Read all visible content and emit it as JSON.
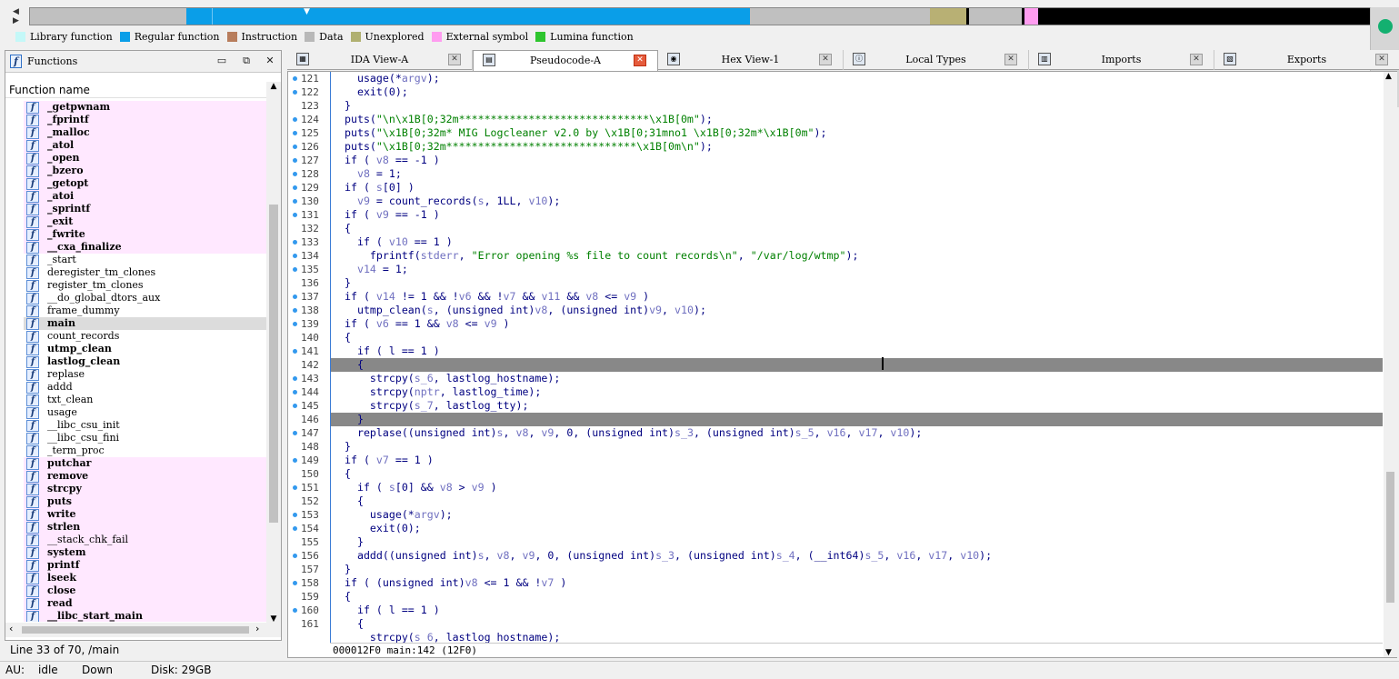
{
  "legend": [
    {
      "label": "Library function",
      "color": "#c4f8f8"
    },
    {
      "label": "Regular function",
      "color": "#0a9ee8"
    },
    {
      "label": "Instruction",
      "color": "#b87d5c"
    },
    {
      "label": "Data",
      "color": "#b8b8b8"
    },
    {
      "label": "Unexplored",
      "color": "#b0b070"
    },
    {
      "label": "External symbol",
      "color": "#ff9cf0"
    },
    {
      "label": "Lumina function",
      "color": "#2ec52e"
    }
  ],
  "functions_panel": {
    "title": "Functions",
    "column_header": "Function name",
    "status": "Line 33 of 70, /main"
  },
  "functions": [
    {
      "name": "_getpwnam",
      "kind": "lib"
    },
    {
      "name": "_fprintf",
      "kind": "lib"
    },
    {
      "name": "_malloc",
      "kind": "lib"
    },
    {
      "name": "_atol",
      "kind": "lib"
    },
    {
      "name": "_open",
      "kind": "lib"
    },
    {
      "name": "_bzero",
      "kind": "lib"
    },
    {
      "name": "_getopt",
      "kind": "lib"
    },
    {
      "name": "_atoi",
      "kind": "lib"
    },
    {
      "name": "_sprintf",
      "kind": "lib"
    },
    {
      "name": "_exit",
      "kind": "lib"
    },
    {
      "name": "_fwrite",
      "kind": "lib"
    },
    {
      "name": "__cxa_finalize",
      "kind": "lib"
    },
    {
      "name": "_start",
      "kind": "reg"
    },
    {
      "name": "deregister_tm_clones",
      "kind": "reg"
    },
    {
      "name": "register_tm_clones",
      "kind": "reg"
    },
    {
      "name": "__do_global_dtors_aux",
      "kind": "reg"
    },
    {
      "name": "frame_dummy",
      "kind": "reg"
    },
    {
      "name": "main",
      "kind": "sel"
    },
    {
      "name": "count_records",
      "kind": "reg"
    },
    {
      "name": "utmp_clean",
      "kind": "bold"
    },
    {
      "name": "lastlog_clean",
      "kind": "bold"
    },
    {
      "name": "replase",
      "kind": "reg"
    },
    {
      "name": "addd",
      "kind": "reg"
    },
    {
      "name": "txt_clean",
      "kind": "reg"
    },
    {
      "name": "usage",
      "kind": "reg"
    },
    {
      "name": "__libc_csu_init",
      "kind": "reg"
    },
    {
      "name": "__libc_csu_fini",
      "kind": "reg"
    },
    {
      "name": "_term_proc",
      "kind": "reg"
    },
    {
      "name": "putchar",
      "kind": "lib"
    },
    {
      "name": "remove",
      "kind": "lib"
    },
    {
      "name": "strcpy",
      "kind": "lib"
    },
    {
      "name": "puts",
      "kind": "lib"
    },
    {
      "name": "write",
      "kind": "lib"
    },
    {
      "name": "strlen",
      "kind": "lib"
    },
    {
      "name": "__stack_chk_fail",
      "kind": "libn"
    },
    {
      "name": "system",
      "kind": "lib"
    },
    {
      "name": "printf",
      "kind": "lib"
    },
    {
      "name": "lseek",
      "kind": "lib"
    },
    {
      "name": "close",
      "kind": "lib"
    },
    {
      "name": "read",
      "kind": "lib"
    },
    {
      "name": "__libc_start_main",
      "kind": "lib"
    }
  ],
  "tabs": [
    {
      "label": "IDA View-A",
      "icon": "graph-icon",
      "active": false
    },
    {
      "label": "Pseudocode-A",
      "icon": "pseudocode-icon",
      "active": true
    },
    {
      "label": "Hex View-1",
      "icon": "hex-icon",
      "active": false
    },
    {
      "label": "Local Types",
      "icon": "info-icon",
      "active": false
    },
    {
      "label": "Imports",
      "icon": "imports-icon",
      "active": false
    },
    {
      "label": "Exports",
      "icon": "exports-icon",
      "active": false
    }
  ],
  "code_lines": [
    {
      "n": "121",
      "dot": true,
      "code": "  usage(*argv);"
    },
    {
      "n": "122",
      "dot": true,
      "code": "  exit(0);"
    },
    {
      "n": "123",
      "dot": false,
      "code": "}"
    },
    {
      "n": "124",
      "dot": true,
      "code": "puts(\"\\n\\x1B[0;32m******************************\\x1B[0m\");"
    },
    {
      "n": "125",
      "dot": true,
      "code": "puts(\"\\x1B[0;32m* MIG Logcleaner v2.0 by \\x1B[0;31mno1 \\x1B[0;32m*\\x1B[0m\");"
    },
    {
      "n": "126",
      "dot": true,
      "code": "puts(\"\\x1B[0;32m******************************\\x1B[0m\\n\");"
    },
    {
      "n": "127",
      "dot": true,
      "code": "if ( v8 == -1 )"
    },
    {
      "n": "128",
      "dot": true,
      "code": "  v8 = 1;"
    },
    {
      "n": "129",
      "dot": true,
      "code": "if ( s[0] )"
    },
    {
      "n": "130",
      "dot": true,
      "code": "  v9 = count_records(s, 1LL, v10);"
    },
    {
      "n": "131",
      "dot": true,
      "code": "if ( v9 == -1 )"
    },
    {
      "n": "132",
      "dot": false,
      "code": "{"
    },
    {
      "n": "133",
      "dot": true,
      "code": "  if ( v10 == 1 )"
    },
    {
      "n": "134",
      "dot": true,
      "code": "    fprintf(stderr, \"Error opening %s file to count records\\n\", \"/var/log/wtmp\");"
    },
    {
      "n": "135",
      "dot": true,
      "code": "  v14 = 1;"
    },
    {
      "n": "136",
      "dot": false,
      "code": "}"
    },
    {
      "n": "137",
      "dot": true,
      "code": "if ( v14 != 1 && !v6 && !v7 && v11 && v8 <= v9 )"
    },
    {
      "n": "138",
      "dot": true,
      "code": "  utmp_clean(s, (unsigned int)v8, (unsigned int)v9, v10);"
    },
    {
      "n": "139",
      "dot": true,
      "code": "if ( v6 == 1 && v8 <= v9 )"
    },
    {
      "n": "140",
      "dot": false,
      "code": "{"
    },
    {
      "n": "141",
      "dot": true,
      "code": "  if ( l == 1 )"
    },
    {
      "n": "142",
      "dot": false,
      "code": "  {",
      "hl": true
    },
    {
      "n": "143",
      "dot": true,
      "code": "    strcpy(s_6, lastlog_hostname);"
    },
    {
      "n": "144",
      "dot": true,
      "code": "    strcpy(nptr, lastlog_time);"
    },
    {
      "n": "145",
      "dot": true,
      "code": "    strcpy(s_7, lastlog_tty);"
    },
    {
      "n": "146",
      "dot": false,
      "code": "  }",
      "hl": true
    },
    {
      "n": "147",
      "dot": true,
      "code": "  replase((unsigned int)s, v8, v9, 0, (unsigned int)s_3, (unsigned int)s_5, v16, v17, v10);"
    },
    {
      "n": "148",
      "dot": false,
      "code": "}"
    },
    {
      "n": "149",
      "dot": true,
      "code": "if ( v7 == 1 )"
    },
    {
      "n": "150",
      "dot": false,
      "code": "{"
    },
    {
      "n": "151",
      "dot": true,
      "code": "  if ( s[0] && v8 > v9 )"
    },
    {
      "n": "152",
      "dot": false,
      "code": "  {"
    },
    {
      "n": "153",
      "dot": true,
      "code": "    usage(*argv);"
    },
    {
      "n": "154",
      "dot": true,
      "code": "    exit(0);"
    },
    {
      "n": "155",
      "dot": false,
      "code": "  }"
    },
    {
      "n": "156",
      "dot": true,
      "code": "  addd((unsigned int)s, v8, v9, 0, (unsigned int)s_3, (unsigned int)s_4, (__int64)s_5, v16, v17, v10);"
    },
    {
      "n": "157",
      "dot": false,
      "code": "}"
    },
    {
      "n": "158",
      "dot": true,
      "code": "if ( (unsigned int)v8 <= 1 && !v7 )"
    },
    {
      "n": "159",
      "dot": false,
      "code": "{"
    },
    {
      "n": "160",
      "dot": true,
      "code": "  if ( l == 1 )"
    },
    {
      "n": "161",
      "dot": false,
      "code": "  {"
    },
    {
      "n": "",
      "dot": false,
      "code": "    strcpy(s_6, lastlog_hostname);"
    }
  ],
  "code_status": "000012F0 main:142 (12F0)",
  "bottom": {
    "au_label": "AU:",
    "au_state": "idle",
    "direction": "Down",
    "disk": "Disk: 29GB"
  }
}
